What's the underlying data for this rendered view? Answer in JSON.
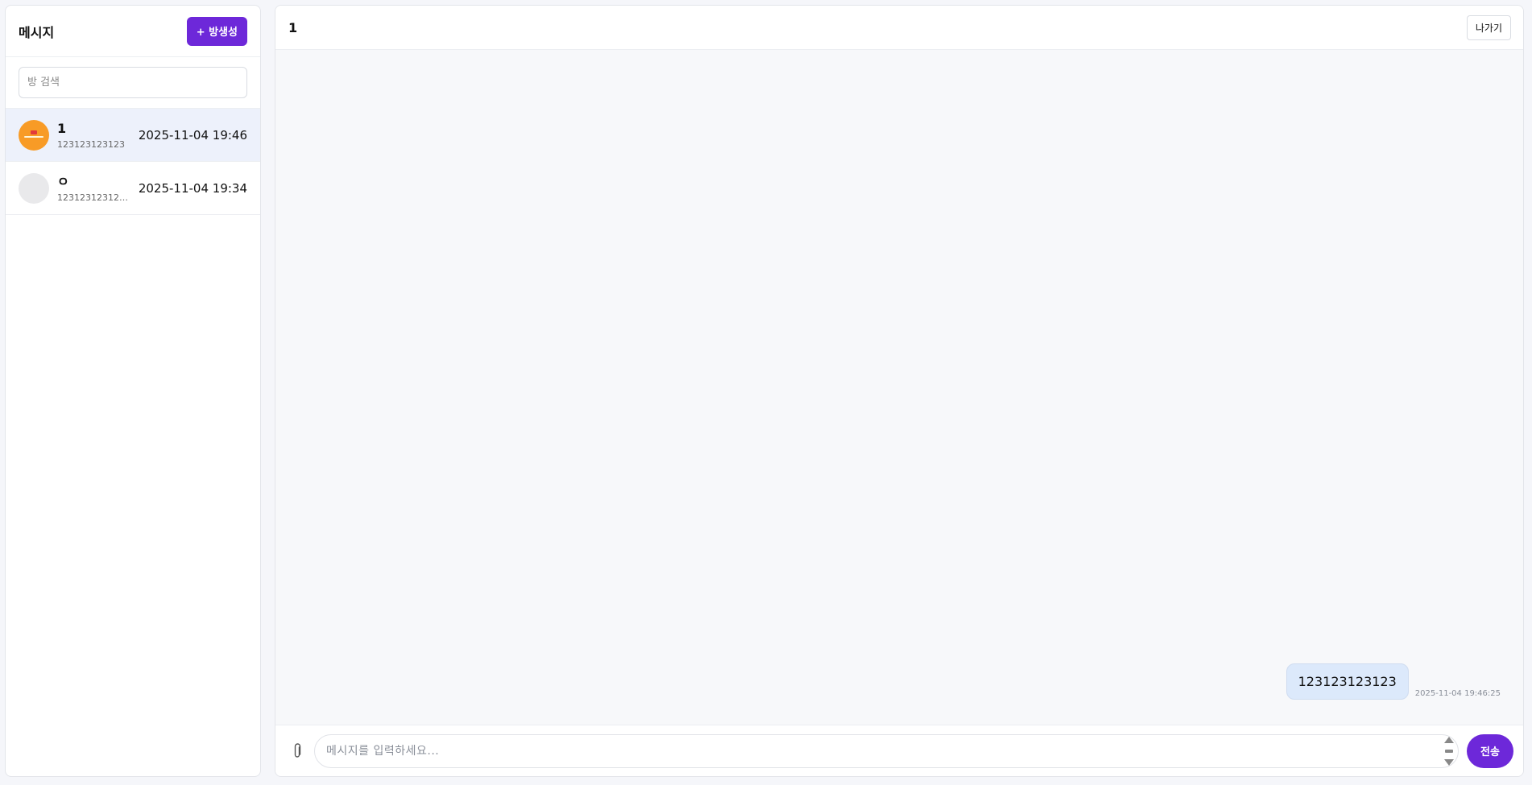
{
  "sidebar": {
    "title": "메시지",
    "new_room_label": "+ 방생성",
    "search_placeholder": "방 검색",
    "rooms": [
      {
        "name": "1",
        "preview": "123123123123",
        "time": "2025-11-04 19:46",
        "avatar": "image",
        "active": true
      },
      {
        "name": "ㅇ",
        "preview": "12312312312312…",
        "time": "2025-11-04 19:34",
        "avatar": "blank",
        "active": false
      }
    ]
  },
  "chat": {
    "title": "1",
    "leave_label": "나가기",
    "messages": [
      {
        "text": "123123123123",
        "time": "2025-11-04 19:46:25",
        "mine": true
      }
    ],
    "composer": {
      "placeholder": "메시지를 입력하세요...",
      "send_label": "전송"
    }
  },
  "colors": {
    "accent": "#6d28d9",
    "bubble": "#dce9fb",
    "active_room": "#edf1fb"
  }
}
